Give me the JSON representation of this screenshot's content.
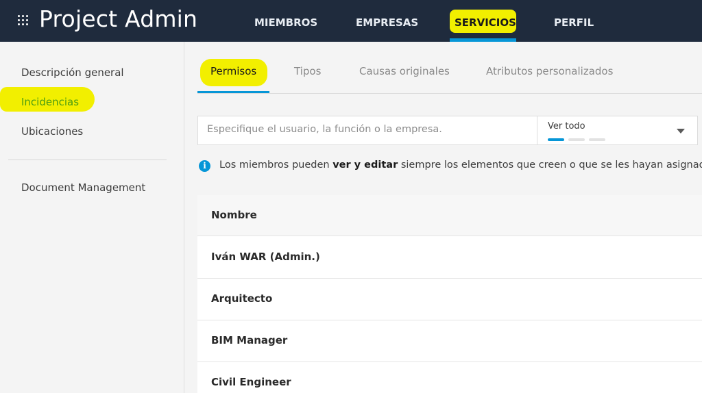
{
  "header": {
    "title": "Project Admin",
    "nav": [
      {
        "label": "MIEMBROS"
      },
      {
        "label": "EMPRESAS"
      },
      {
        "label": "SERVICIOS"
      },
      {
        "label": "PERFIL"
      }
    ],
    "active_nav": "SERVICIOS",
    "grid_icon": "apps-grid-icon"
  },
  "sidebar": {
    "items": [
      {
        "label": "Descripción general"
      },
      {
        "label": "Incidencias"
      },
      {
        "label": "Ubicaciones"
      },
      {
        "label": "Document Management"
      }
    ],
    "active_item": "Incidencias"
  },
  "tabs": [
    {
      "label": "Permisos"
    },
    {
      "label": "Tipos"
    },
    {
      "label": "Causas originales"
    },
    {
      "label": "Atributos personalizados"
    }
  ],
  "active_tab": "Permisos",
  "search": {
    "placeholder": "Especifique el usuario, la función o la empresa."
  },
  "filter": {
    "selected": "Ver todo",
    "icon": "chevron-down-icon"
  },
  "info": {
    "icon": "info-icon",
    "prefix": "Los miembros pueden ",
    "bold": "ver y editar",
    "suffix": " siempre los elementos que creen o que se les hayan asignad"
  },
  "table": {
    "header": "Nombre",
    "rows": [
      {
        "name": "Iván WAR (Admin.)"
      },
      {
        "name": "Arquitecto"
      },
      {
        "name": "BIM Manager"
      },
      {
        "name": "Civil Engineer"
      }
    ]
  },
  "colors": {
    "topbar": "#1f2b3d",
    "accent": "#0696d7",
    "highlight": "#f2ef00",
    "active_sidebar_text": "#4c9d12"
  }
}
